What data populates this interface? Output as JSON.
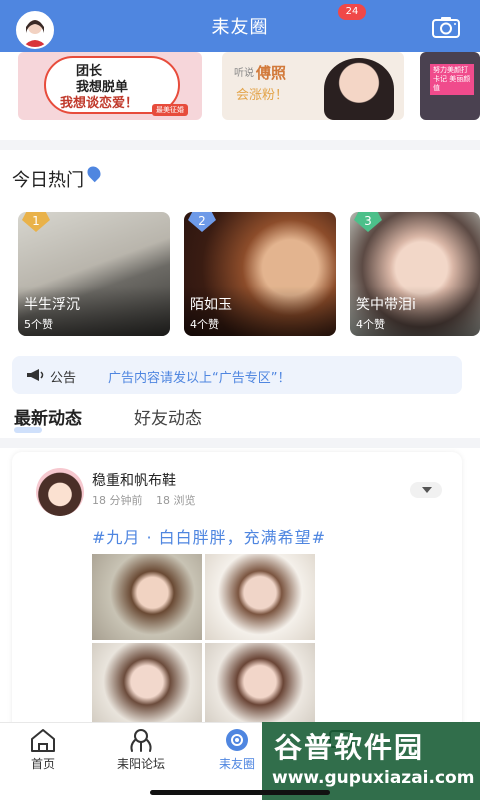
{
  "header": {
    "title": "耒友圈",
    "avatar_icon": "user-avatar",
    "camera_icon": "camera-icon"
  },
  "banners": {
    "b1_lines": [
      "团长",
      "我想脱单",
      "我想谈恋爱！"
    ],
    "b1_tag": "最美征婚",
    "b2_small": "听说",
    "b2_big": "傅照",
    "b2_sub": "会涨粉！",
    "b3_pill": "努力美颜打卡记 美丽颜值"
  },
  "hot": {
    "title": "今日热门",
    "items": [
      {
        "rank": "1",
        "name": "半生浮沉",
        "likes": "5个赞"
      },
      {
        "rank": "2",
        "name": "陌如玉",
        "likes": "4个赞"
      },
      {
        "rank": "3",
        "name": "笑中带泪i",
        "likes": "4个赞"
      }
    ]
  },
  "notice": {
    "label": "公告",
    "text": "广告内容请发以上“广告专区”！"
  },
  "tabs": {
    "latest": "最新动态",
    "friends": "好友动态"
  },
  "post": {
    "author": "稳重和帆布鞋",
    "time": "18 分钟前",
    "views": "18 浏览",
    "text": "#九月 · 白白胖胖，充满希望#"
  },
  "nav": {
    "home": "首页",
    "forum": "耒阳论坛",
    "circle": "耒友圈",
    "badge": "24"
  },
  "watermark": {
    "line1": "谷普软件园",
    "line2": "www.gupuxiazai.com"
  },
  "colors": {
    "primary": "#4f86e0",
    "badge": "#f04848"
  }
}
